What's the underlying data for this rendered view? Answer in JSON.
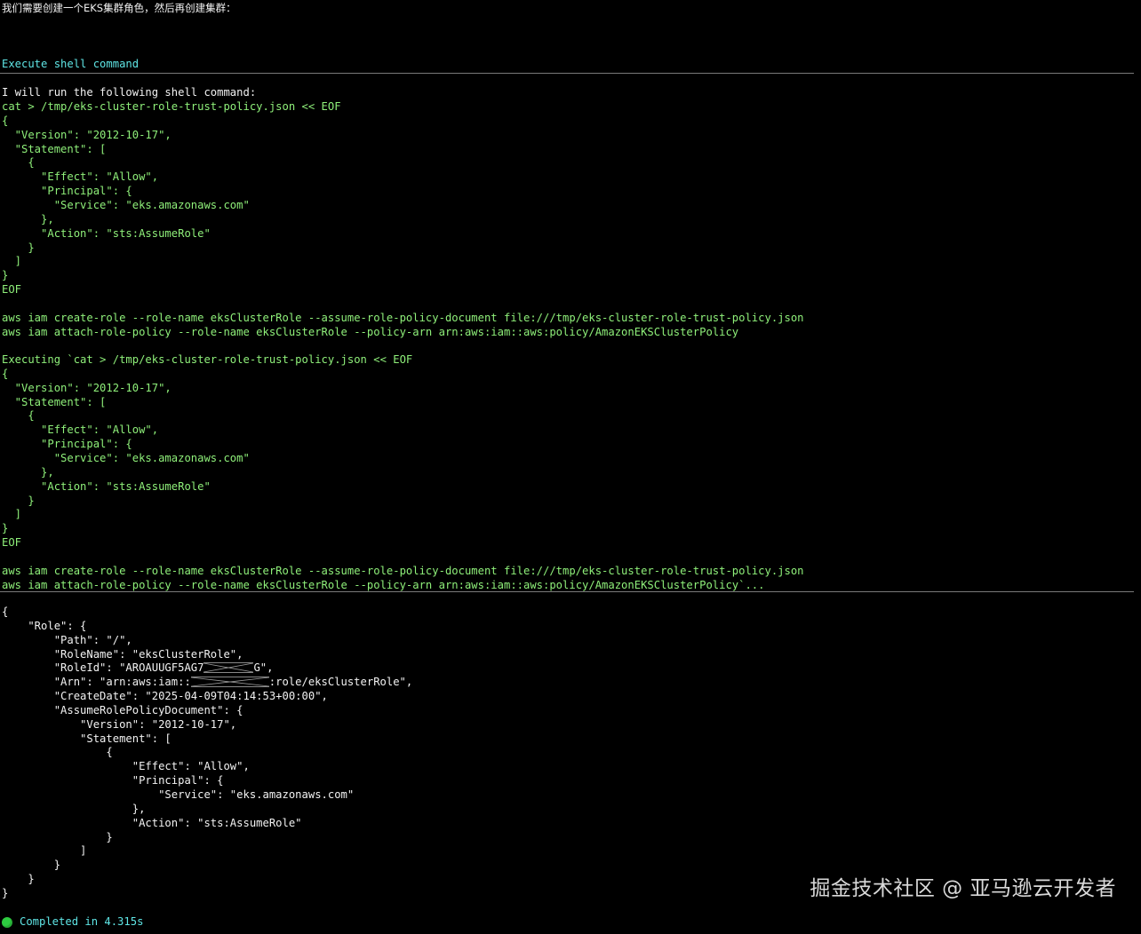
{
  "prompt": "我们需要创建一个EKS集群角色，然后再创建集群：",
  "tool_header": "Execute shell command",
  "command_block": {
    "intro": "I will run the following shell command:",
    "lines": [
      "cat > /tmp/eks-cluster-role-trust-policy.json << EOF",
      "{",
      "  \"Version\": \"2012-10-17\",",
      "  \"Statement\": [",
      "    {",
      "      \"Effect\": \"Allow\",",
      "      \"Principal\": {",
      "        \"Service\": \"eks.amazonaws.com\"",
      "      },",
      "      \"Action\": \"sts:AssumeRole\"",
      "    }",
      "  ]",
      "}",
      "EOF",
      "",
      "aws iam create-role --role-name eksClusterRole --assume-role-policy-document file:///tmp/eks-cluster-role-trust-policy.json",
      "aws iam attach-role-policy --role-name eksClusterRole --policy-arn arn:aws:iam::aws:policy/AmazonEKSClusterPolicy"
    ]
  },
  "executing_block": {
    "lines": [
      "Executing `cat > /tmp/eks-cluster-role-trust-policy.json << EOF",
      "{",
      "  \"Version\": \"2012-10-17\",",
      "  \"Statement\": [",
      "    {",
      "      \"Effect\": \"Allow\",",
      "      \"Principal\": {",
      "        \"Service\": \"eks.amazonaws.com\"",
      "      },",
      "      \"Action\": \"sts:AssumeRole\"",
      "    }",
      "  ]",
      "}",
      "EOF",
      "",
      "aws iam create-role --role-name eksClusterRole --assume-role-policy-document file:///tmp/eks-cluster-role-trust-policy.json",
      "aws iam attach-role-policy --role-name eksClusterRole --policy-arn arn:aws:iam::aws:policy/AmazonEKSClusterPolicy`..."
    ]
  },
  "output_block": {
    "lines": [
      "{",
      "    \"Role\": {",
      "        \"Path\": \"/\",",
      "        \"RoleName\": \"eksClusterRole\","
    ],
    "roleid_prefix": "        \"RoleId\": \"AROAUUGF5AG7",
    "roleid_suffix": "G\",",
    "arn_prefix": "        \"Arn\": \"arn:aws:iam::",
    "arn_suffix": ":role/eksClusterRole\",",
    "lines_after": [
      "        \"CreateDate\": \"2025-04-09T04:14:53+00:00\",",
      "        \"AssumeRolePolicyDocument\": {",
      "            \"Version\": \"2012-10-17\",",
      "            \"Statement\": [",
      "                {",
      "                    \"Effect\": \"Allow\",",
      "                    \"Principal\": {",
      "                        \"Service\": \"eks.amazonaws.com\"",
      "                    },",
      "                    \"Action\": \"sts:AssumeRole\"",
      "                }",
      "            ]",
      "        }",
      "    }",
      "}"
    ]
  },
  "status": {
    "text": "Completed in 4.315s",
    "dot_color": "#2ecc40"
  },
  "watermark": "掘金技术社区 @ 亚马逊云开发者"
}
